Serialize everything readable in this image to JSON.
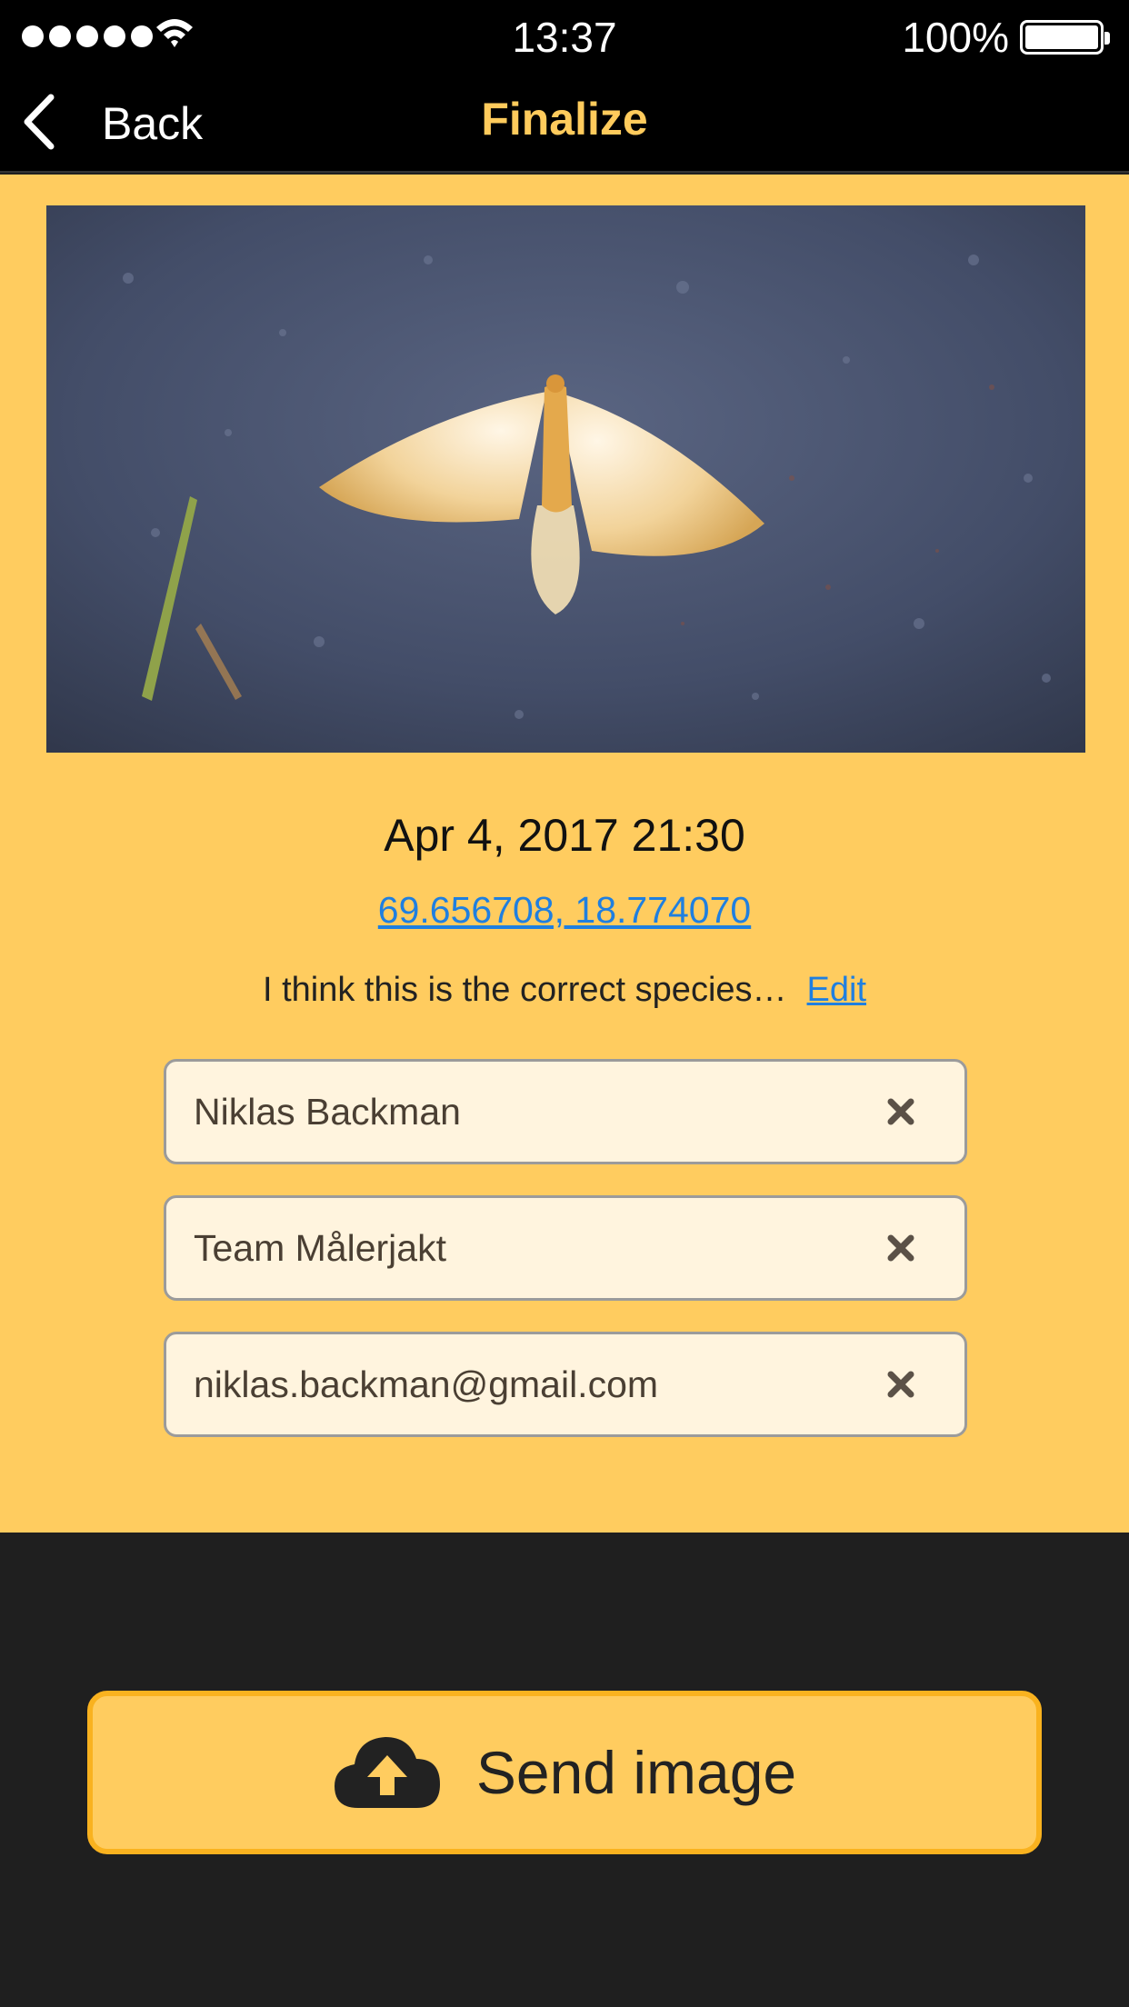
{
  "status_bar": {
    "time": "13:37",
    "battery": "100%",
    "battery_level": 1.0,
    "signal_bars": 5
  },
  "nav": {
    "back_label": "Back",
    "title": "Finalize"
  },
  "observation": {
    "date_time": "Apr 4, 2017 21:30",
    "coordinates": "69.656708, 18.774070",
    "species_note": "I think this is the correct species…",
    "edit_label": "Edit"
  },
  "fields": {
    "name": "Niklas Backman",
    "team": "Team Målerjakt",
    "email": "niklas.backman@gmail.com"
  },
  "send_button": {
    "label": "Send image",
    "icon": "cloud-upload-icon"
  },
  "colors": {
    "accent": "#ffcc5f",
    "link": "#1f7fe0",
    "nav_title": "#ffcb5c",
    "bottom_bg": "#1f1f1f",
    "field_bg": "#fff4de"
  }
}
